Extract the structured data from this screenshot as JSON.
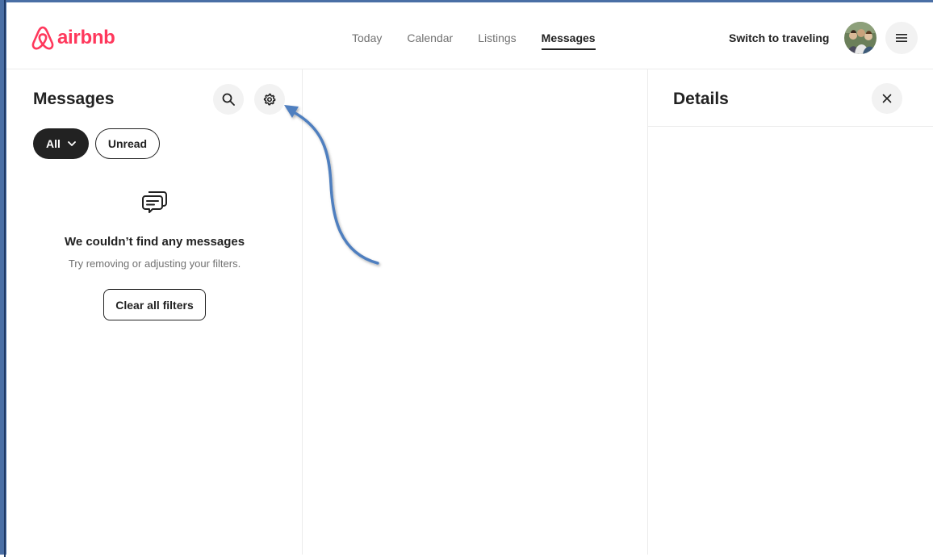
{
  "brand": {
    "name": "airbnb",
    "color": "#ff385c"
  },
  "nav": {
    "items": [
      {
        "label": "Today",
        "active": false
      },
      {
        "label": "Calendar",
        "active": false
      },
      {
        "label": "Listings",
        "active": false
      },
      {
        "label": "Messages",
        "active": true
      }
    ]
  },
  "header": {
    "switch_label": "Switch to traveling",
    "avatar_icon": "user-avatar-photo",
    "menu_icon": "hamburger-menu-icon"
  },
  "messages_panel": {
    "title": "Messages",
    "search_icon": "search-icon",
    "settings_icon": "gear-icon",
    "filters": {
      "all_label": "All",
      "unread_label": "Unread"
    },
    "empty_state": {
      "icon": "chat-bubbles-icon",
      "title": "We couldn’t find any messages",
      "subtitle": "Try removing or adjusting your filters.",
      "button_label": "Clear all filters"
    }
  },
  "details_panel": {
    "title": "Details",
    "close_icon": "close-icon"
  },
  "annotation": {
    "arrow_color": "#4f7fbf",
    "points_to": "gear-icon"
  }
}
